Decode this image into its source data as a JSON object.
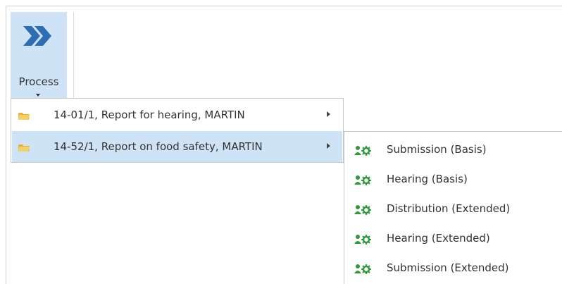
{
  "ribbon": {
    "process_button": {
      "label": "Process"
    }
  },
  "process_menu": {
    "items": [
      {
        "label": "14-01/1, Report for hearing, MARTIN",
        "selected": false
      },
      {
        "label": "14-52/1, Report on food safety, MARTIN",
        "selected": true
      }
    ]
  },
  "submenu": {
    "items": [
      {
        "label": "Submission (Basis)"
      },
      {
        "label": "Hearing (Basis)"
      },
      {
        "label": "Distribution (Extended)"
      },
      {
        "label": "Hearing (Extended)"
      },
      {
        "label": "Submission (Extended)"
      }
    ]
  },
  "colors": {
    "selected_bg": "#cfe3f6",
    "process_icon_blue": "#2e6db4",
    "folder_yellow": "#f2c94c",
    "gear_green": "#2f9a3a"
  },
  "icons": {
    "process_button": "double-chevron-right-icon",
    "menu_item": "folder-icon",
    "submenu_item": "workflow-gear-icon",
    "submenu_arrow": "chevron-right-icon",
    "dropdown_arrow": "caret-down-icon"
  }
}
